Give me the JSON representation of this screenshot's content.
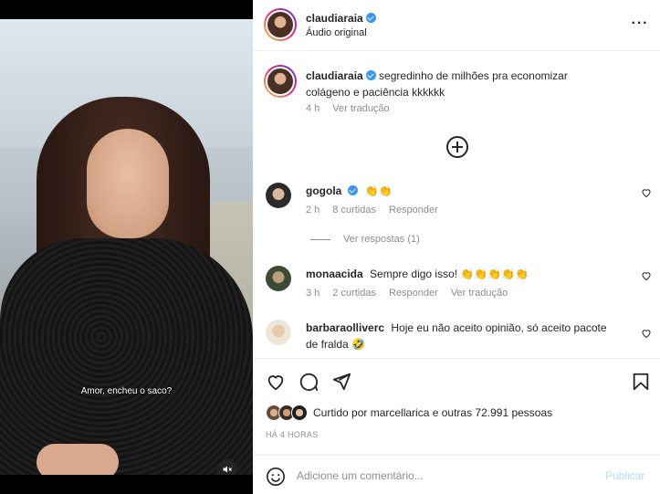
{
  "video": {
    "subtitle": "Amor, encheu o saco?",
    "mute_icon": "speaker-muted-icon"
  },
  "header": {
    "username": "claudiaraia",
    "audio": "Áudio original",
    "more_icon": "more-horizontal-icon"
  },
  "caption": {
    "username": "claudiaraia",
    "text": "segredinho de milhões pra economizar colágeno e paciência kkkkkk",
    "time": "4 h",
    "translate": "Ver tradução"
  },
  "load_more_icon": "plus-circle-icon",
  "comments": [
    {
      "username": "gogola",
      "text": "👏👏",
      "time": "2 h",
      "likes": "8 curtidas",
      "reply": "Responder",
      "view_replies": "Ver respostas (1)"
    },
    {
      "username": "monaacida",
      "text": "Sempre digo isso! 👏👏👏👏👏",
      "time": "3 h",
      "likes": "2 curtidas",
      "reply": "Responder",
      "translate": "Ver tradução"
    },
    {
      "username": "barbaraolliverc",
      "text": "Hoje eu não aceito opinião, só aceito pacote de fralda 🤣"
    }
  ],
  "actions": {
    "like_icon": "heart-icon",
    "comment_icon": "comment-icon",
    "share_icon": "send-icon",
    "save_icon": "bookmark-icon"
  },
  "likes": {
    "prefix": "Curtido por ",
    "user": "marcellarica",
    "middle": " e ",
    "others": "outras 72.991 pessoas"
  },
  "posted": "HÁ 4 HORAS",
  "add_comment": {
    "placeholder": "Adicione um comentário...",
    "publish": "Publicar",
    "emoji_icon": "emoji-icon"
  },
  "colors": {
    "verified": "#3897f0",
    "muted_text": "#8e8e8e",
    "publish_disabled": "#b3dbff"
  }
}
